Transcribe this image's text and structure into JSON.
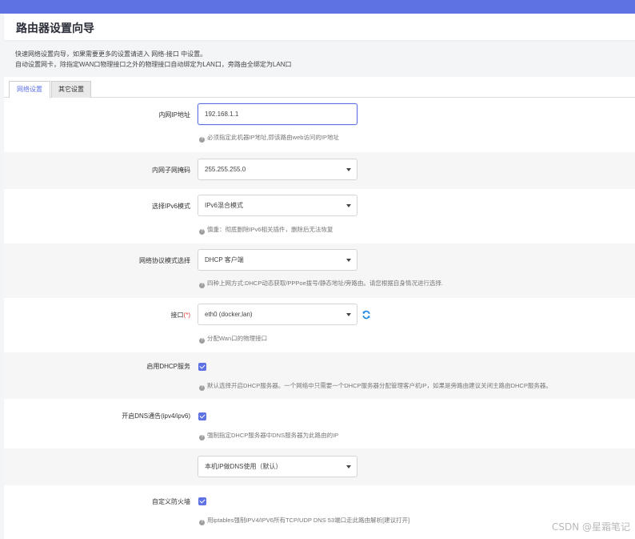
{
  "header": {
    "title": "路由器设置向导"
  },
  "description": {
    "line1": "快速网络设置向导，如果需要更多的设置请进入 网络-接口 中设置。",
    "line2": "自动设置网卡，除指定WAN口物理接口之外的物理接口自动绑定为LAN口，旁路由全绑定为LAN口"
  },
  "tabs": [
    {
      "label": "网络设置",
      "active": true
    },
    {
      "label": "其它设置",
      "active": false
    }
  ],
  "form": {
    "lan_ip": {
      "label": "内网IP地址",
      "value": "192.168.1.1",
      "hint": "必须指定此机器IP地址,即该路由web访问的IP地址"
    },
    "netmask": {
      "label": "内网子网掩码",
      "value": "255.255.255.0"
    },
    "ipv6_mode": {
      "label": "选择IPv6模式",
      "value": "IPv6混合模式",
      "hint": "慎重：彻底删除IPv6相关插件，删除后无法恢复"
    },
    "proto": {
      "label": "网络协议模式选择",
      "value": "DHCP 客户端",
      "hint": "四种上网方式:DHCP动态获取/PPPoe拨号/静态地址/旁路由。请您根据自身情况进行选择."
    },
    "iface": {
      "label": "接口",
      "required_mark": "(*)",
      "value": "eth0 (docker,lan)",
      "hint": "分配Wan口的物理接口"
    },
    "dhcp": {
      "label": "启用DHCP服务",
      "checked": true,
      "hint": "默认选择开启DHCP服务器。一个网络中只需要一个DHCP服务器分配管理客户机IP，如果是旁路由建议关闭主路由DHCP服务器。"
    },
    "dns": {
      "label": "开启DNS通告(ipv4/ipv6)",
      "checked": true,
      "hint": "强制指定DHCP服务器中DNS服务器为此路由的IP"
    },
    "dns_mode": {
      "value": "本机IP做DNS使用（默认）"
    },
    "firewall": {
      "label": "自定义防火墙",
      "checked": true,
      "hint": "用iptables强制IPV4/IPV6所有TCP/UDP DNS 53端口走此路由解析[建议打开]"
    }
  },
  "watermark": "CSDN @星霜笔记",
  "colors": {
    "accent": "#5e72e4",
    "refresh": "#1e88e5"
  }
}
